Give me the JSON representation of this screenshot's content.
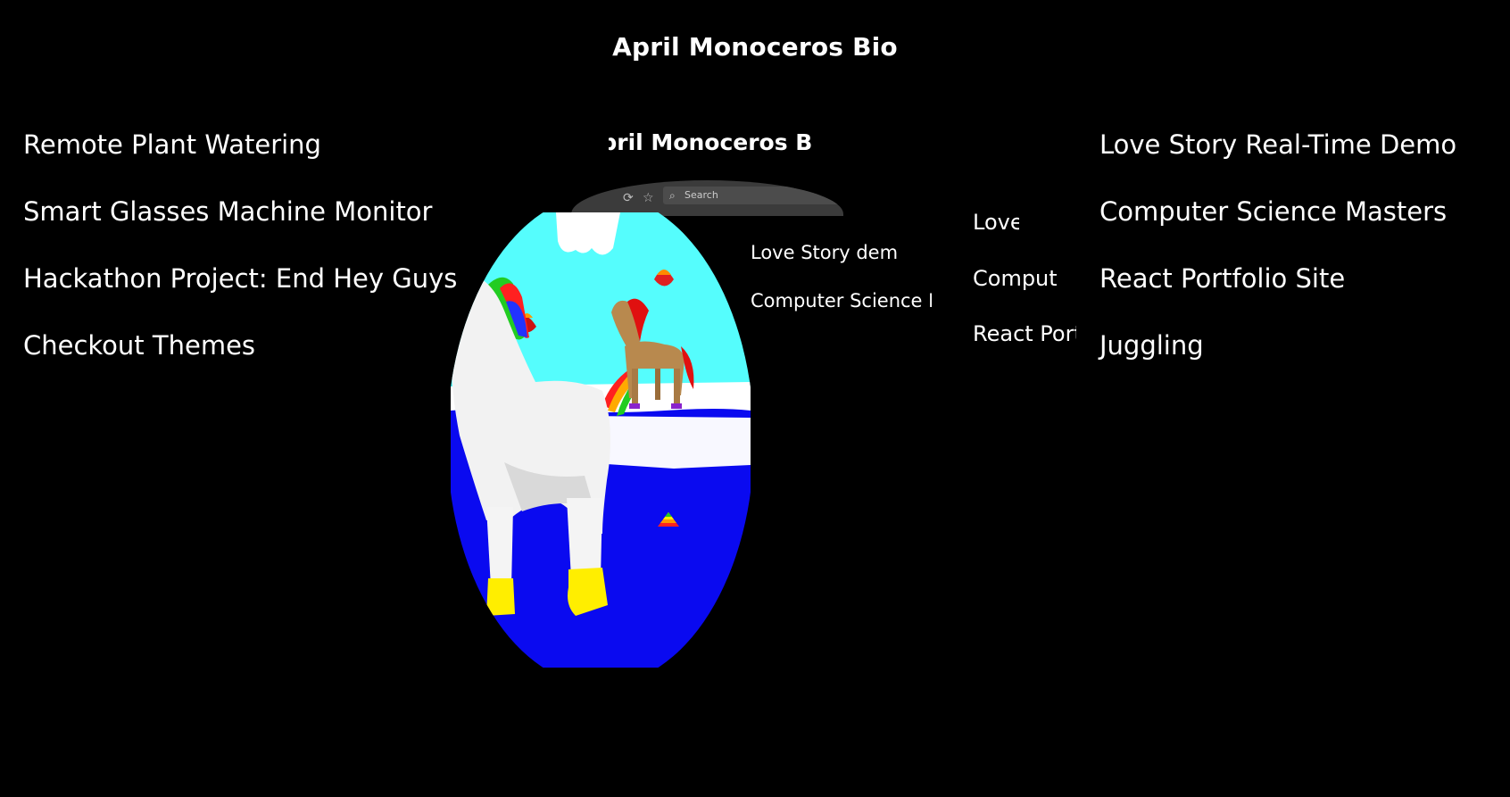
{
  "page": {
    "title": "April Monoceros Bio"
  },
  "nav_left": [
    {
      "label": "Remote Plant Watering"
    },
    {
      "label": "Smart Glasses Machine Monitor"
    },
    {
      "label": "Hackathon Project: End Hey Guys"
    },
    {
      "label": "Checkout Themes"
    }
  ],
  "nav_right": [
    {
      "label": "Love Story Real-Time Demo"
    },
    {
      "label": "Computer Science Masters"
    },
    {
      "label": "React Portfolio Site"
    },
    {
      "label": "Juggling"
    }
  ],
  "preview": {
    "title": "April Monoceros Bio",
    "search_placeholder": "Search",
    "links_inner": [
      {
        "label": "Love Story demo"
      },
      {
        "label": "Computer Science Masters"
      }
    ],
    "links_outer": [
      {
        "label": "Love Story"
      },
      {
        "label": "Computer"
      },
      {
        "label": "React Portfolio"
      }
    ]
  },
  "scene": {
    "sky_color": "#55fdfd",
    "water_color": "#0a0af0",
    "snow_color": "#ffffff",
    "unicorn_color": "#f4f4f4",
    "horse_color": "#b8894e",
    "mane_color": "#e01010",
    "hoof_color": "#ffee00"
  }
}
